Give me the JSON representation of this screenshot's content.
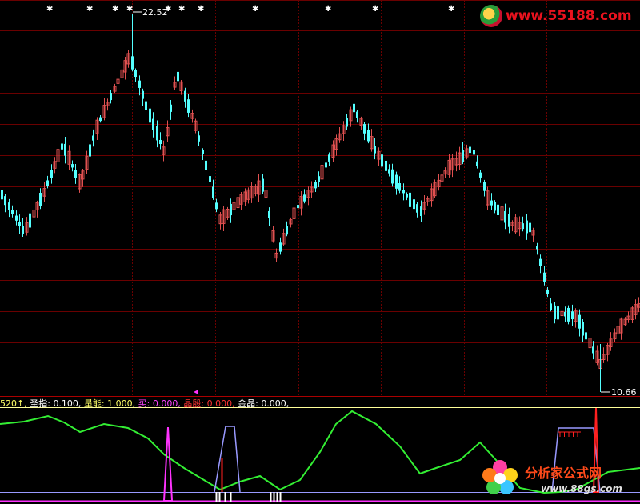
{
  "price_panel": {
    "high_label": "22.52",
    "low_label": "10.66",
    "star_glyph": "✱"
  },
  "indicator_panel": {
    "legend": {
      "prefix": "520↑,",
      "items": [
        {
          "label": "圣指:",
          "value": "0.100,",
          "color": "#ffffff"
        },
        {
          "label": "量能:",
          "value": "1.000,",
          "color": "#ffff66"
        },
        {
          "label": "买:",
          "value": "0.000,",
          "color": "#ff44ff"
        },
        {
          "label": "晶殷:",
          "value": "0.000,",
          "color": "#ff3333"
        },
        {
          "label": "金晶:",
          "value": "0.000,",
          "color": "#ffffff"
        }
      ],
      "prefix_color": "#ffff66"
    }
  },
  "watermarks": {
    "top": "www.55188.com",
    "bottom_cn": "分析家公式网",
    "bottom_url": "www.88gs.com"
  },
  "colors": {
    "up": "#e05050",
    "down": "#54ffff",
    "grid": "#6a0000",
    "green_line": "#33ee33",
    "magenta": "#ff33ff",
    "red": "#ff2020",
    "violet": "#9999ff"
  }
}
